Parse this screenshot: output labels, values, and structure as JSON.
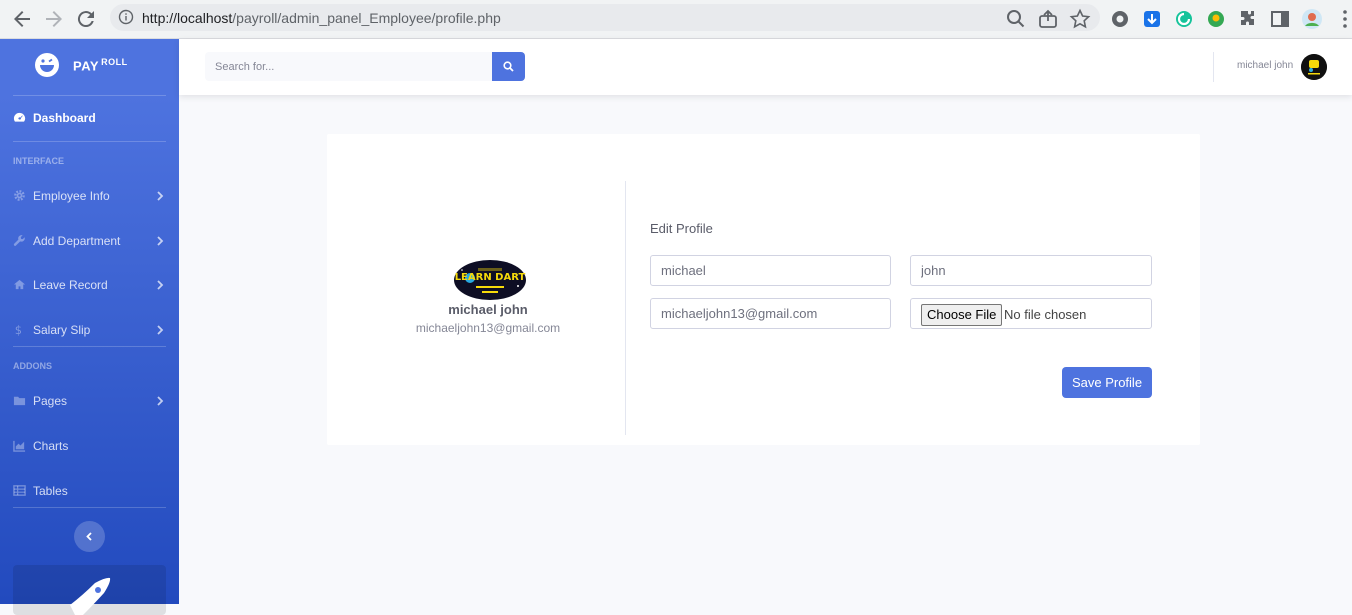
{
  "browser": {
    "url_host": "http://localhost",
    "url_path": "/payroll/admin_panel_Employee/profile.php"
  },
  "sidebar": {
    "brand": "PAY",
    "brand_sup": "ROLL",
    "dashboard": "Dashboard",
    "heading_interface": "INTERFACE",
    "items_interface": [
      {
        "label": "Employee Info",
        "icon": "gear-icon"
      },
      {
        "label": "Add Department",
        "icon": "wrench-icon"
      },
      {
        "label": "Leave Record",
        "icon": "home-icon"
      },
      {
        "label": "Salary Slip",
        "icon": "dollar-icon"
      }
    ],
    "heading_addons": "ADDONS",
    "items_addons": [
      {
        "label": "Pages",
        "icon": "folder-icon"
      },
      {
        "label": "Charts",
        "icon": "chart-area-icon"
      },
      {
        "label": "Tables",
        "icon": "table-icon"
      }
    ]
  },
  "topbar": {
    "search_placeholder": "Search for...",
    "user_name": "michael john"
  },
  "profile": {
    "name": "michael john",
    "email": "michaeljohn13@gmail.com",
    "avatar_text": "LEARN DART"
  },
  "form": {
    "title": "Edit Profile",
    "first_name": "michael",
    "last_name": "john",
    "email": "michaeljohn13@gmail.com",
    "file_button": "Choose File",
    "file_status": "No file chosen",
    "save_label": "Save Profile"
  },
  "colors": {
    "primary": "#4e73df",
    "background": "#f8f9fc"
  }
}
